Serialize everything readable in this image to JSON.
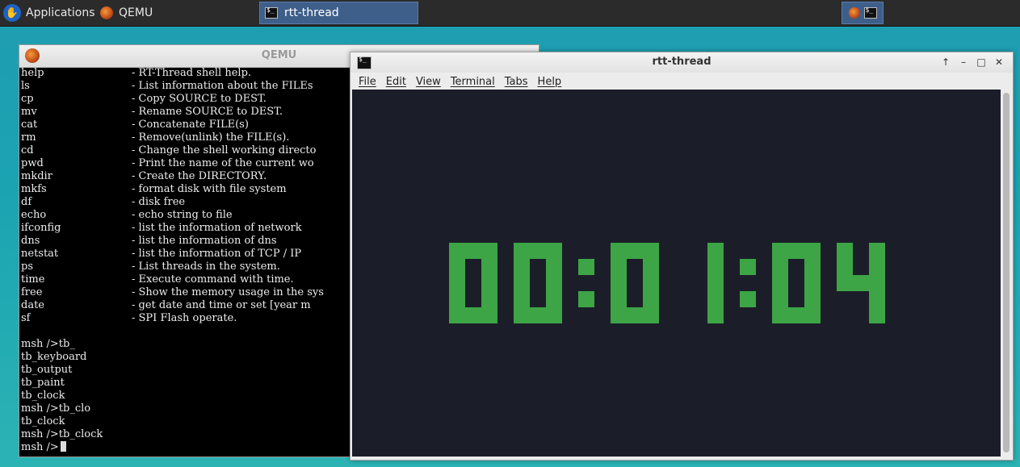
{
  "panel": {
    "applications_label": "Applications",
    "launcher_qemu_label": "QEMU",
    "taskbar_active_label": "rtt-thread"
  },
  "qemu_window": {
    "title": "QEMU",
    "commands": [
      {
        "name": "help",
        "desc": "- RT-Thread shell help."
      },
      {
        "name": "ls",
        "desc": "- List information about the FILEs"
      },
      {
        "name": "cp",
        "desc": "- Copy SOURCE to DEST."
      },
      {
        "name": "mv",
        "desc": "- Rename SOURCE to DEST."
      },
      {
        "name": "cat",
        "desc": "- Concatenate FILE(s)"
      },
      {
        "name": "rm",
        "desc": "- Remove(unlink) the FILE(s)."
      },
      {
        "name": "cd",
        "desc": "- Change the shell working directo"
      },
      {
        "name": "pwd",
        "desc": "- Print the name of the current wo"
      },
      {
        "name": "mkdir",
        "desc": "- Create the DIRECTORY."
      },
      {
        "name": "mkfs",
        "desc": "- format disk with file system"
      },
      {
        "name": "df",
        "desc": "- disk free"
      },
      {
        "name": "echo",
        "desc": "- echo string to file"
      },
      {
        "name": "ifconfig",
        "desc": "- list the information of network"
      },
      {
        "name": "dns",
        "desc": "- list the information of dns"
      },
      {
        "name": "netstat",
        "desc": "- list the information of TCP / IP"
      },
      {
        "name": "ps",
        "desc": "- List threads in the system."
      },
      {
        "name": "time",
        "desc": "- Execute command with time."
      },
      {
        "name": "free",
        "desc": "- Show the memory usage in the sys"
      },
      {
        "name": "date",
        "desc": "- get date and time or set [year m"
      },
      {
        "name": "sf",
        "desc": "- SPI Flash operate."
      }
    ],
    "history": [
      "msh />tb_",
      "tb_keyboard",
      "tb_output",
      "tb_paint",
      "tb_clock",
      "msh />tb_clo",
      "tb_clock",
      "msh />tb_clock"
    ],
    "prompt": "msh />"
  },
  "terminal_window": {
    "title": "rtt-thread",
    "menu": [
      "File",
      "Edit",
      "View",
      "Terminal",
      "Tabs",
      "Help"
    ],
    "clock_text": "00:01:04",
    "clock_color": "#3da545",
    "background_color": "#1b1e29"
  },
  "icons": {
    "apps": "xfce-logo-icon",
    "qemu": "qemu-icon",
    "terminal": "terminal-icon"
  }
}
